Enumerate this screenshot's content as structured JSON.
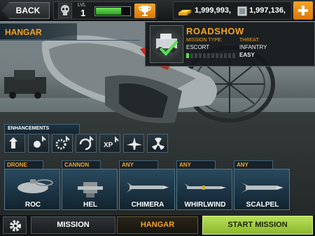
{
  "topbar": {
    "back_label": "BACK",
    "level_label": "LVL",
    "level_value": "1",
    "xp_progress": 0.72,
    "gold_amount": "1,999,993,",
    "silver_amount": "1,997,136,"
  },
  "hangar": {
    "title": "HANGAR"
  },
  "mission": {
    "name": "ROADSHOW",
    "mission_type_label": "MISSION TYPE:",
    "mission_type_value": "ESCORT",
    "threat_label": "THREAT:",
    "threat_value": "INFANTRY",
    "difficulty_text": "EASY",
    "difficulty_segments_total": 12,
    "difficulty_segments_filled": 1
  },
  "enhancements": {
    "title": "ENHANCEMENTS",
    "slots": [
      {
        "icon": "rank-up-icon"
      },
      {
        "icon": "burst-up-icon"
      },
      {
        "icon": "gear-up-icon"
      },
      {
        "icon": "reload-up-icon"
      },
      {
        "icon": "xp-up-icon",
        "text": "XP"
      },
      {
        "icon": "aircraft-icon"
      },
      {
        "icon": "radiation-icon"
      }
    ]
  },
  "weapons": [
    {
      "category": "DRONE",
      "name": "ROC",
      "icon": "drone-icon"
    },
    {
      "category": "CANNON",
      "name": "HEL",
      "icon": "cannon-icon"
    },
    {
      "category": "ANY",
      "name": "CHIMERA",
      "icon": "missile-icon"
    },
    {
      "category": "ANY",
      "name": "WHIRLWIND",
      "icon": "rocket-icon"
    },
    {
      "category": "ANY",
      "name": "SCALPEL",
      "icon": "bomb-icon"
    }
  ],
  "bottom": {
    "mission_label": "MISSION",
    "hangar_label": "HANGAR",
    "start_label": "START MISSION"
  },
  "colors": {
    "accent_orange": "#f5a425",
    "start_green": "#a6cf44",
    "xp_green": "#53e24d"
  }
}
